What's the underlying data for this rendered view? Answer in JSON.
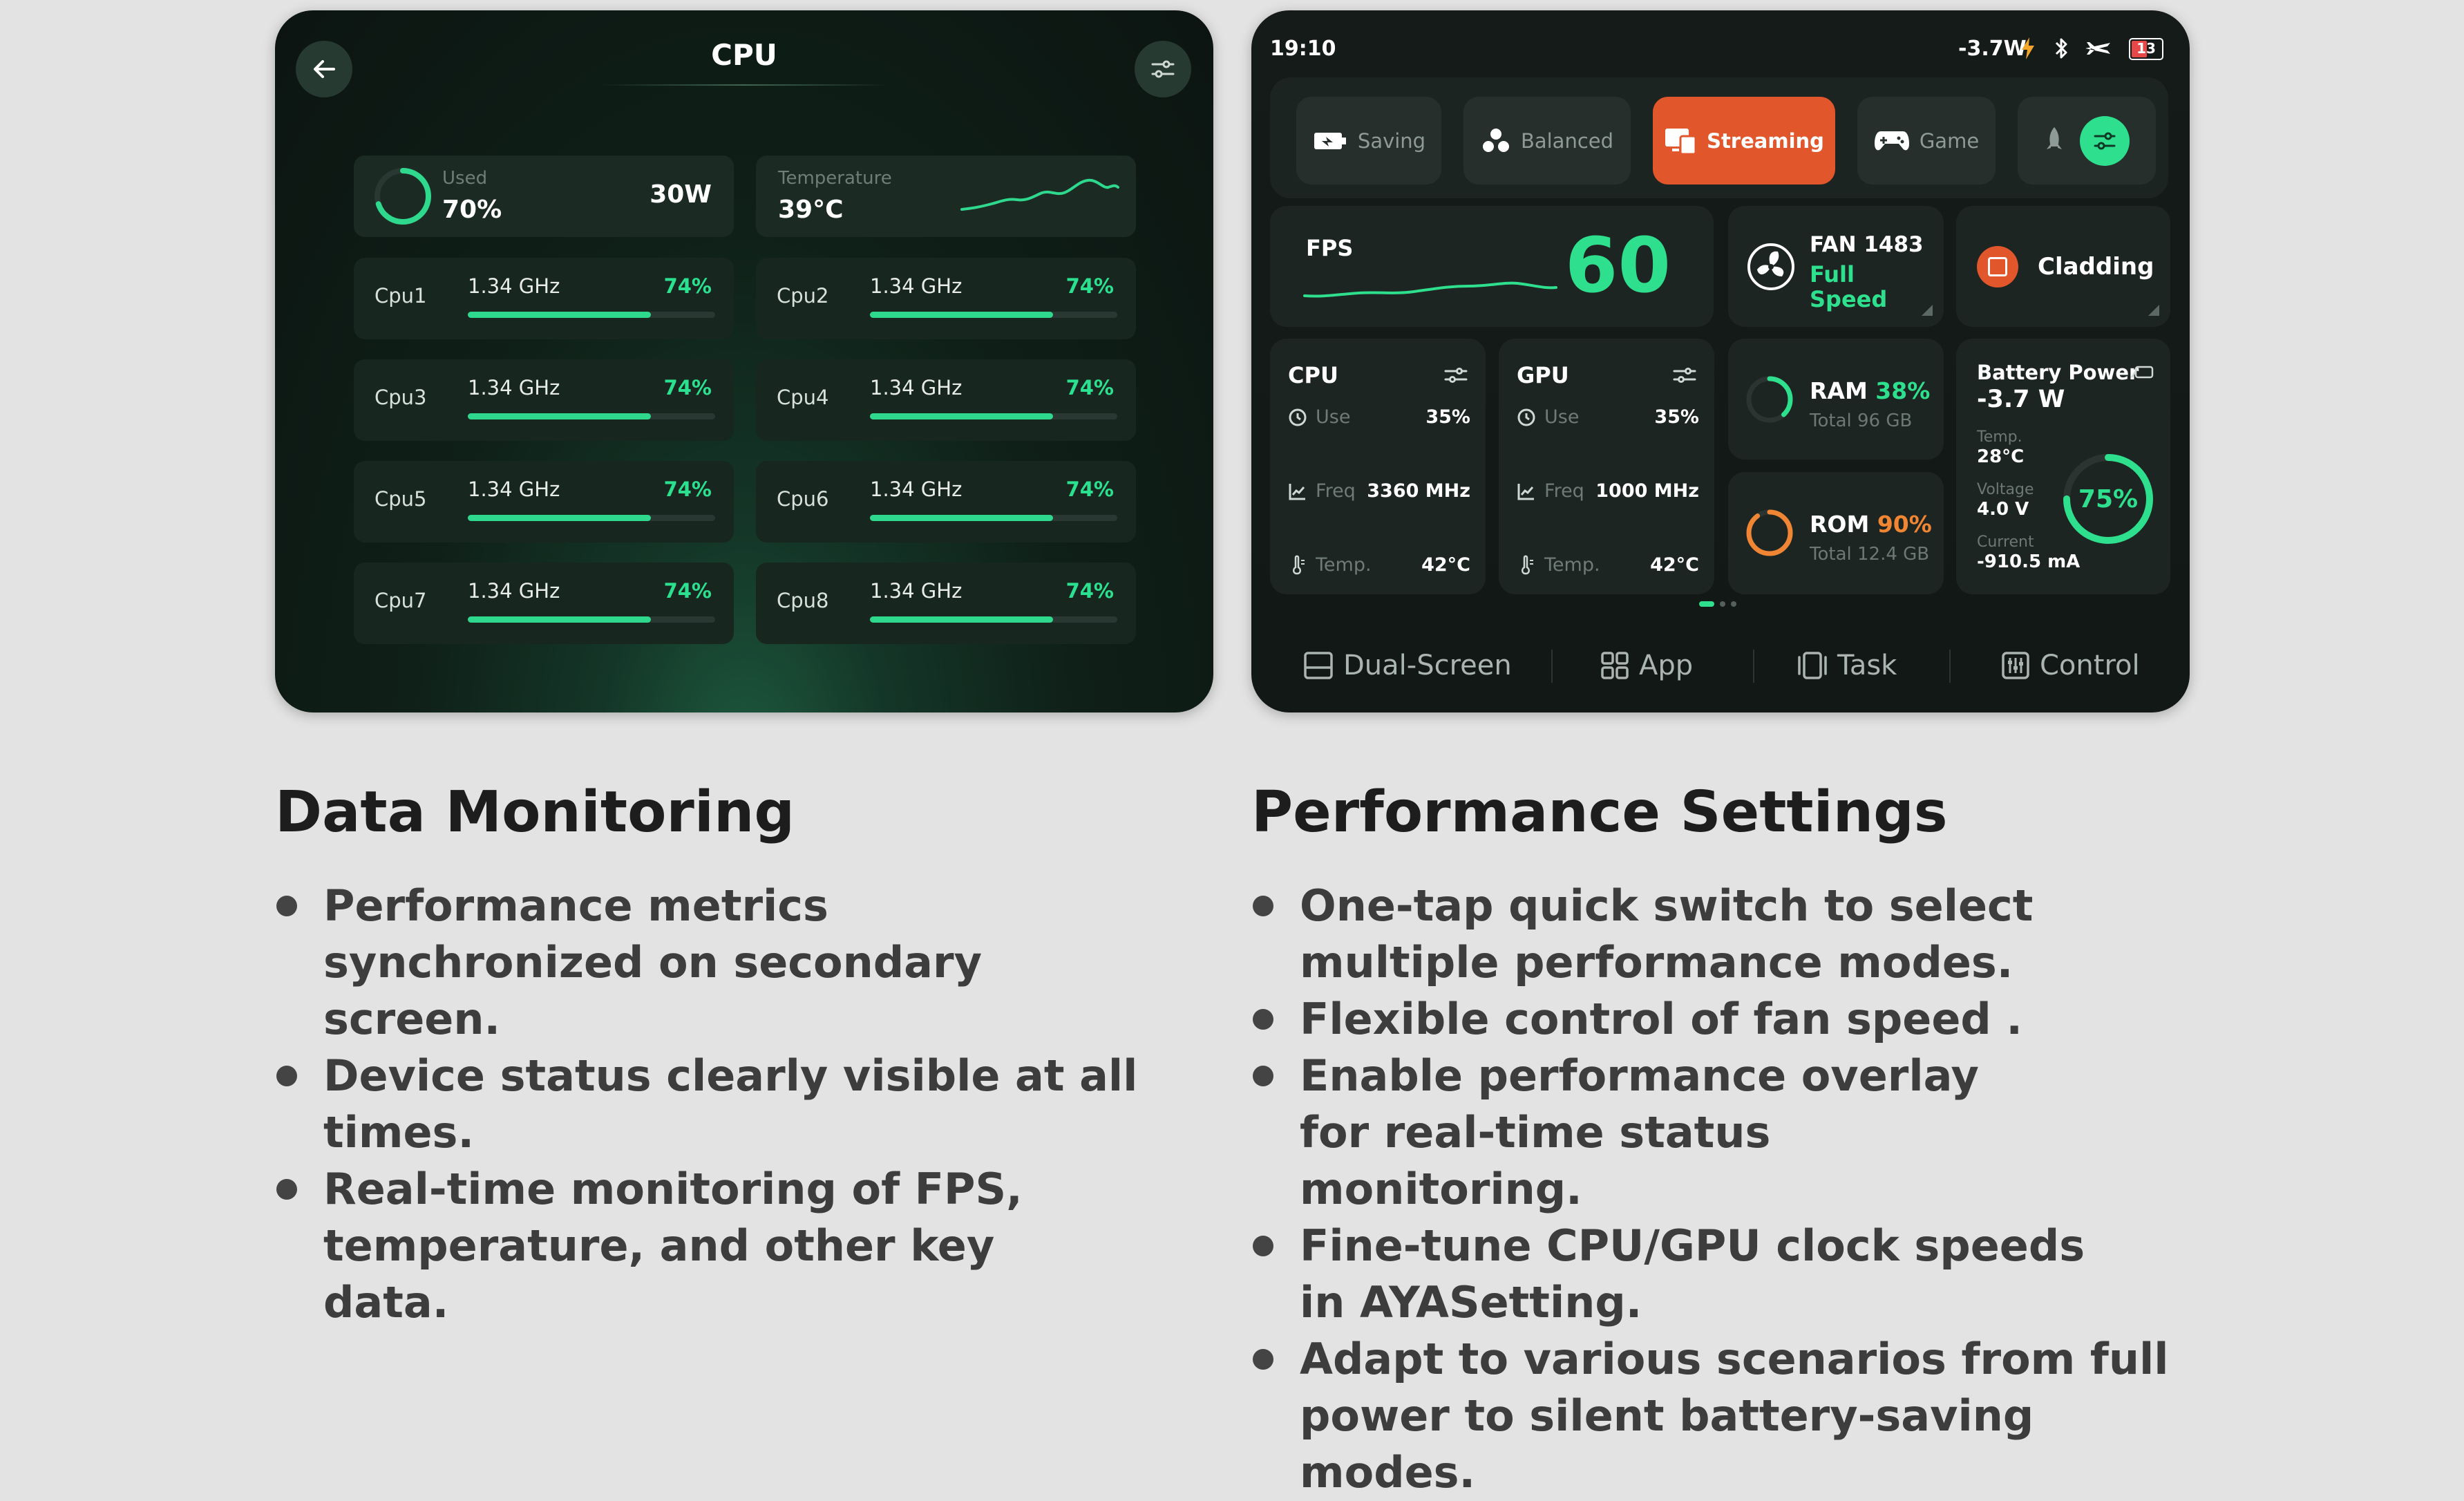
{
  "left_panel": {
    "title": "CPU",
    "summary": {
      "used_label": "Used",
      "used_value": "70%",
      "used_fraction": 0.7,
      "power": "30W",
      "temp_label": "Temperature",
      "temp_value": "39°C"
    },
    "cores": [
      {
        "name": "Cpu1",
        "freq": "1.34 GHz",
        "pct": "74%",
        "fraction": 0.74
      },
      {
        "name": "Cpu2",
        "freq": "1.34 GHz",
        "pct": "74%",
        "fraction": 0.74
      },
      {
        "name": "Cpu3",
        "freq": "1.34 GHz",
        "pct": "74%",
        "fraction": 0.74
      },
      {
        "name": "Cpu4",
        "freq": "1.34 GHz",
        "pct": "74%",
        "fraction": 0.74
      },
      {
        "name": "Cpu5",
        "freq": "1.34 GHz",
        "pct": "74%",
        "fraction": 0.74
      },
      {
        "name": "Cpu6",
        "freq": "1.34 GHz",
        "pct": "74%",
        "fraction": 0.74
      },
      {
        "name": "Cpu7",
        "freq": "1.34 GHz",
        "pct": "74%",
        "fraction": 0.74
      },
      {
        "name": "Cpu8",
        "freq": "1.34 GHz",
        "pct": "74%",
        "fraction": 0.74
      }
    ],
    "icons": {
      "back": "arrow-left-icon",
      "settings": "sliders-icon"
    }
  },
  "right_panel": {
    "status_bar": {
      "time": "19:10",
      "power": "-3.7W",
      "battery": "13"
    },
    "modes": [
      {
        "label": "Saving",
        "icon": "battery-saver-icon",
        "active": false
      },
      {
        "label": "Balanced",
        "icon": "balance-icon",
        "active": false
      },
      {
        "label": "Streaming",
        "icon": "streaming-icon",
        "active": true
      },
      {
        "label": "Game",
        "icon": "gamepad-icon",
        "active": false
      }
    ],
    "fps": {
      "label": "FPS",
      "value": "60"
    },
    "fan": {
      "label": "FAN 1483",
      "status_line1": "Full",
      "status_line2": "Speed"
    },
    "cladding": {
      "label": "Cladding"
    },
    "cpu": {
      "title": "CPU",
      "use_label": "Use",
      "use_value": "35%",
      "freq_label": "Freq",
      "freq_value": "3360 MHz",
      "temp_label": "Temp.",
      "temp_value": "42°C"
    },
    "gpu": {
      "title": "GPU",
      "use_label": "Use",
      "use_value": "35%",
      "freq_label": "Freq",
      "freq_value": "1000 MHz",
      "temp_label": "Temp.",
      "temp_value": "42°C"
    },
    "ram": {
      "label": "RAM",
      "pct": "38%",
      "fraction": 0.38,
      "total": "Total 96 GB"
    },
    "rom": {
      "label": "ROM",
      "pct": "90%",
      "fraction": 0.9,
      "total": "Total 12.4 GB"
    },
    "battery": {
      "title": "Battery Power",
      "power": "-3.7 W",
      "temp_label": "Temp.",
      "temp_value": "28°C",
      "voltage_label": "Voltage",
      "voltage_value": "4.0 V",
      "current_label": "Current",
      "current_value": "-910.5 mA",
      "pct": "75%",
      "fraction": 0.75
    },
    "nav": [
      {
        "label": "Dual-Screen",
        "icon": "dual-screen-icon"
      },
      {
        "label": "App",
        "icon": "app-grid-icon"
      },
      {
        "label": "Task",
        "icon": "task-icon"
      },
      {
        "label": "Control",
        "icon": "control-icon"
      }
    ],
    "colors": {
      "accent_green": "#2ee08d",
      "accent_orange": "#e2562b"
    }
  },
  "sections": {
    "left": {
      "heading": "Data Monitoring",
      "bullets": [
        "Performance metrics synchronized on secondary screen.",
        "Device status clearly visible at all times.",
        "Real-time monitoring of FPS, temperature, and other key data."
      ]
    },
    "right": {
      "heading": "Performance Settings",
      "bullets": [
        "One-tap quick switch to select multiple performance modes.",
        "Flexible control of fan speed .",
        "Enable performance overlay for real-time status monitoring.",
        "Fine-tune CPU/GPU clock speeds in AYASetting.",
        "Adapt to various scenarios from full power to silent battery-saving modes."
      ]
    }
  }
}
